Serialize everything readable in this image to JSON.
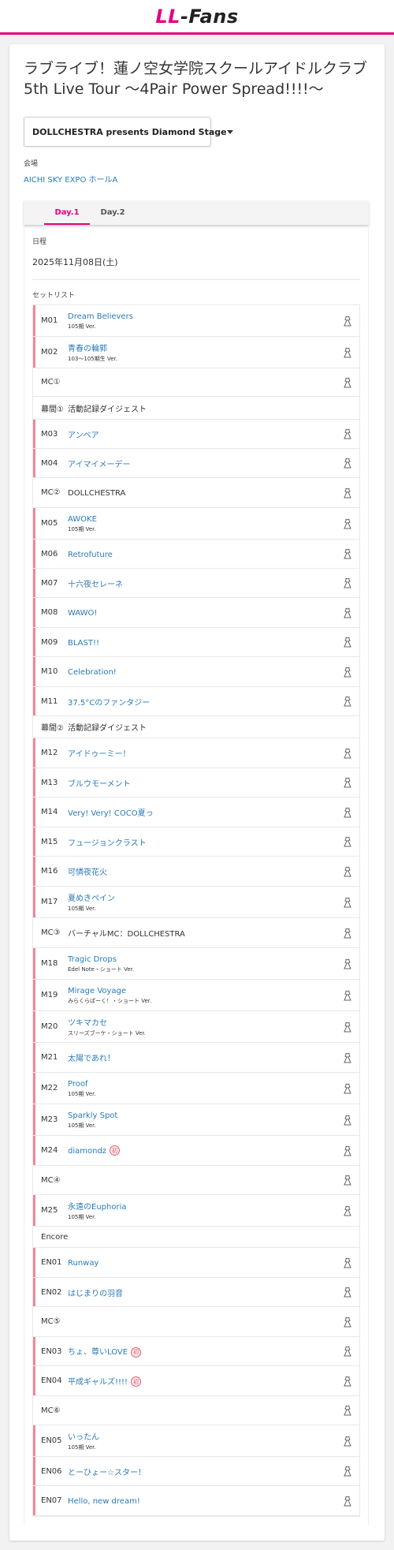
{
  "header": {
    "logo_ll": "LL",
    "logo_fans": "-Fans"
  },
  "title": "ラブライブ！蓮ノ空女学院スクールアイドルクラブ 5th Live Tour 〜4Pair Power Spread!!!!〜",
  "stage_select": {
    "value": "DOLLCHESTRA presents Diamond Stage"
  },
  "venue_label": "会場",
  "venue": "AICHI SKY EXPO ホールA",
  "tabs": [
    {
      "label": "Day.1"
    },
    {
      "label": "Day.2"
    }
  ],
  "date_label": "日程",
  "date": "2025年11月08日(土)",
  "setlist_label": "セットリスト",
  "setlist": [
    {
      "type": "song",
      "num": "M01",
      "name": "Dream Believers",
      "ver": "105期 Ver.",
      "h": 40
    },
    {
      "type": "song",
      "num": "M02",
      "name": "青春の輪郭",
      "ver": "103〜105期生 Ver.",
      "h": 40
    },
    {
      "type": "mc",
      "num": "MC①",
      "name": "",
      "h": 36
    },
    {
      "type": "section",
      "num": "幕間①",
      "name": "活動記録ダイジェスト",
      "h": 29
    },
    {
      "type": "song",
      "num": "M03",
      "name": "アンベア",
      "ver": "",
      "h": 37
    },
    {
      "type": "song",
      "num": "M04",
      "name": "アイマイメーデー",
      "ver": "",
      "h": 37
    },
    {
      "type": "mc",
      "num": "MC②",
      "name": "DOLLCHESTRA",
      "h": 38
    },
    {
      "type": "song",
      "num": "M05",
      "name": "AWOKE",
      "ver": "105期 Ver.",
      "h": 40
    },
    {
      "type": "song",
      "num": "M06",
      "name": "Retrofuture",
      "ver": "",
      "h": 37
    },
    {
      "type": "song",
      "num": "M07",
      "name": "十六夜セレーネ",
      "ver": "",
      "h": 37
    },
    {
      "type": "song",
      "num": "M08",
      "name": "WAWO!",
      "ver": "",
      "h": 38
    },
    {
      "type": "song",
      "num": "M09",
      "name": "BLAST!!",
      "ver": "",
      "h": 37
    },
    {
      "type": "song",
      "num": "M10",
      "name": "Celebration!",
      "ver": "",
      "h": 38
    },
    {
      "type": "song",
      "num": "M11",
      "name": "37.5°Cのファンタジー",
      "ver": "",
      "h": 37
    },
    {
      "type": "section",
      "num": "幕間②",
      "name": "活動記録ダイジェスト",
      "h": 28
    },
    {
      "type": "song",
      "num": "M12",
      "name": "アイドゥーミー！",
      "ver": "",
      "h": 38
    },
    {
      "type": "song",
      "num": "M13",
      "name": "ブルウモーメント",
      "ver": "",
      "h": 37
    },
    {
      "type": "song",
      "num": "M14",
      "name": "Very! Very! COCO夏っ",
      "ver": "",
      "h": 38
    },
    {
      "type": "song",
      "num": "M15",
      "name": "フュージョンクラスト",
      "ver": "",
      "h": 37
    },
    {
      "type": "song",
      "num": "M16",
      "name": "可憐夜花火",
      "ver": "",
      "h": 38
    },
    {
      "type": "song",
      "num": "M17",
      "name": "夏めきペイン",
      "ver": "105期 Ver.",
      "h": 40
    },
    {
      "type": "mc",
      "num": "MC③",
      "name": "バーチャルMC：DOLLCHESTRA",
      "h": 38
    },
    {
      "type": "song",
      "num": "M18",
      "name": "Tragic Drops",
      "ver": "Edel Note・ショート Ver.",
      "h": 40
    },
    {
      "type": "song",
      "num": "M19",
      "name": "Mirage Voyage",
      "ver": "みらくらぱーく！・ショート Ver.",
      "h": 40
    },
    {
      "type": "song",
      "num": "M20",
      "name": "ツキマカセ",
      "ver": "スリーズブーケ・ショート Ver.",
      "h": 40
    },
    {
      "type": "song",
      "num": "M21",
      "name": "太陽であれ！",
      "ver": "",
      "h": 38
    },
    {
      "type": "song",
      "num": "M22",
      "name": "Proof",
      "ver": "105期 Ver.",
      "h": 40
    },
    {
      "type": "song",
      "num": "M23",
      "name": "Sparkly Spot",
      "ver": "105期 Ver.",
      "h": 40
    },
    {
      "type": "song",
      "num": "M24",
      "name": "diamondz",
      "ver": "",
      "badge": "初",
      "h": 38
    },
    {
      "type": "mc",
      "num": "MC④",
      "name": "",
      "h": 37
    },
    {
      "type": "song",
      "num": "M25",
      "name": "永遠のEuphoria",
      "ver": "105期 Ver.",
      "h": 40
    },
    {
      "type": "section",
      "num": "Encore",
      "name": "",
      "h": 27
    },
    {
      "type": "song",
      "num": "EN01",
      "name": "Runway",
      "ver": "",
      "h": 38
    },
    {
      "type": "song",
      "num": "EN02",
      "name": "はじまりの羽音",
      "ver": "",
      "h": 37
    },
    {
      "type": "mc",
      "num": "MC⑤",
      "name": "",
      "h": 38
    },
    {
      "type": "song",
      "num": "EN03",
      "name": "ちょ、尊いLOVE",
      "ver": "",
      "badge": "初",
      "h": 37
    },
    {
      "type": "song",
      "num": "EN04",
      "name": "平成ギャルズ!!!!",
      "ver": "",
      "badge": "初",
      "h": 38
    },
    {
      "type": "mc",
      "num": "MC⑥",
      "name": "",
      "h": 37
    },
    {
      "type": "song",
      "num": "EN05",
      "name": "いったん",
      "ver": "105期 Ver.",
      "h": 40
    },
    {
      "type": "song",
      "num": "EN06",
      "name": "とーひょー☆スター！",
      "ver": "",
      "h": 37
    },
    {
      "type": "song",
      "num": "EN07",
      "name": "Hello, new dream!",
      "ver": "",
      "h": 38
    }
  ],
  "colors": {
    "accent": "#e4007f",
    "link": "#2a7ab8",
    "song_bar": "#ee8899"
  },
  "row_icon": "costume-dress-icon"
}
